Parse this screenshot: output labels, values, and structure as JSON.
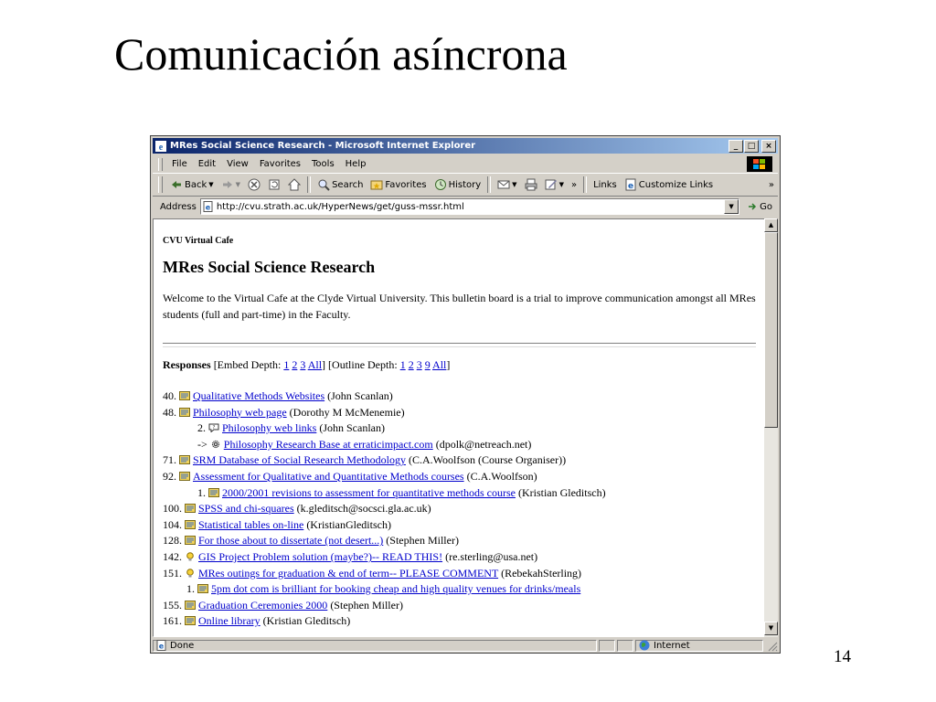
{
  "slide": {
    "title": "Comunicación asíncrona",
    "page_number": "14"
  },
  "window": {
    "title": "MRes Social Science Research - Microsoft Internet Explorer",
    "buttons": {
      "minimize": "_",
      "maximize": "□",
      "close": "×"
    }
  },
  "menu": [
    "File",
    "Edit",
    "View",
    "Favorites",
    "Tools",
    "Help"
  ],
  "toolbar": {
    "back": "Back",
    "search": "Search",
    "favorites": "Favorites",
    "history": "History",
    "overflow": "»",
    "links": "Links",
    "customize_links": "Customize Links"
  },
  "address": {
    "label": "Address",
    "url": "http://cvu.strath.ac.uk/HyperNews/get/guss-mssr.html",
    "go": "Go"
  },
  "page": {
    "site_name": "CVU Virtual Cafe",
    "heading": "MRes Social Science Research",
    "intro": "Welcome to the Virtual Cafe at the Clyde Virtual University. This bulletin board is a trial to improve communication amongst all MRes students (full and part-time) in the Faculty.",
    "responses_label": "Responses",
    "embed_depth_label": "[Embed Depth:",
    "embed_depth_links": [
      "1",
      "2",
      "3",
      "All"
    ],
    "outline_depth_label": "] [Outline Depth:",
    "outline_depth_links": [
      "1",
      "2",
      "3",
      "9",
      "All"
    ],
    "outline_close": "]"
  },
  "posts": [
    {
      "num": "40.",
      "icon": "note-icon",
      "title": "Qualitative Methods Websites",
      "author": "(John Scanlan)",
      "level": 0
    },
    {
      "num": "48.",
      "icon": "note-icon",
      "title": "Philosophy web page",
      "author": "(Dorothy M McMenemie)",
      "level": 0
    },
    {
      "num": "2.",
      "icon": "question-icon",
      "title": "Philosophy web links",
      "author": "(John Scanlan)",
      "level": 1
    },
    {
      "num": "->",
      "icon": "gear-icon",
      "title": "Philosophy Research Base at erraticimpact.com",
      "author": "(dpolk@netreach.net)",
      "level": 1
    },
    {
      "num": "71.",
      "icon": "note-icon",
      "title": "SRM Database of Social Research Methodology",
      "author": "(C.A.Woolfson (Course Organiser))",
      "level": 0
    },
    {
      "num": "92.",
      "icon": "note-icon",
      "title": "Assessment for Qualitative and Quantitative Methods courses",
      "author": "(C.A.Woolfson)",
      "level": 0
    },
    {
      "num": "1.",
      "icon": "note-icon",
      "title": "2000/2001 revisions to assessment for quantitative methods course",
      "author": "(Kristian Gleditsch)",
      "level": 1
    },
    {
      "num": "100.",
      "icon": "note-icon",
      "title": "SPSS and chi-squares",
      "author": "(k.gleditsch@socsci.gla.ac.uk)",
      "level": 0
    },
    {
      "num": "104.",
      "icon": "note-icon",
      "title": "Statistical tables on-line",
      "author": "(KristianGleditsch)",
      "level": 0
    },
    {
      "num": "128.",
      "icon": "note-icon",
      "title": "For those about to dissertate (not desert...)",
      "author": "(Stephen Miller)",
      "level": 0
    },
    {
      "num": "142.",
      "icon": "bulb-icon",
      "title": "GIS Project Problem solution (maybe?)-- READ THIS!",
      "author": "(re.sterling@usa.net)",
      "level": 0
    },
    {
      "num": "151.",
      "icon": "bulb-icon",
      "title": "MRes outings for graduation & end of term-- PLEASE COMMENT",
      "author": "(RebekahSterling)",
      "level": 0
    },
    {
      "num": "1.",
      "icon": "note-icon",
      "title": "5pm dot com is brilliant for booking cheap and high quality venues for drinks/meals",
      "author": "",
      "level": 2
    },
    {
      "num": "155.",
      "icon": "note-icon",
      "title": "Graduation Ceremonies 2000",
      "author": "(Stephen Miller)",
      "level": 0
    },
    {
      "num": "161.",
      "icon": "note-icon",
      "title": "Online library",
      "author": "(Kristian Gleditsch)",
      "level": 0
    }
  ],
  "status": {
    "text": "Done",
    "zone": "Internet"
  }
}
